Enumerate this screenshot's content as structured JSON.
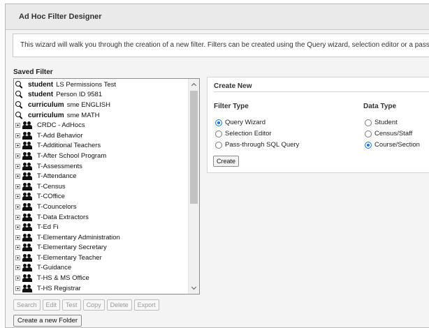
{
  "window": {
    "title": "Ad Hoc Filter Designer",
    "intro": "This wizard will walk you through the creation of a new filter. Filters can be created using the Query wizard, selection editor or a pass-through"
  },
  "saved_filter": {
    "label": "Saved Filter",
    "searches": [
      {
        "bold": "student",
        "text": "LS Permissions Test"
      },
      {
        "bold": "student",
        "text": "Person ID 9581"
      },
      {
        "bold": "curriculum",
        "text": "sme ENGLISH"
      },
      {
        "bold": "curriculum",
        "text": "sme MATH"
      }
    ],
    "folders": [
      "CRDC - AdHocs",
      "T-Add Behavior",
      "T-Additional Teachers",
      "T-After School Program",
      "T-Assessments",
      "T-Attendance",
      "T-Census",
      "T-COffice",
      "T-Councelors",
      "T-Data Extractors",
      "T-Ed Fi",
      "T-Elementary Administration",
      "T-Elementary Secretary",
      "T-Elementary Teacher",
      "T-Guidance",
      "T-HS & MS Office",
      "T-HS Registrar"
    ]
  },
  "actions": {
    "search": "Search",
    "edit": "Edit",
    "test": "Test",
    "copy": "Copy",
    "delete": "Delete",
    "export": "Export",
    "new_folder": "Create a new Folder"
  },
  "create_new": {
    "title": "Create New",
    "filter_type_label": "Filter Type",
    "data_type_label": "Data Type",
    "filter_types": [
      {
        "label": "Query Wizard",
        "checked": true
      },
      {
        "label": "Selection Editor",
        "checked": false
      },
      {
        "label": "Pass-through SQL Query",
        "checked": false
      }
    ],
    "data_types": [
      {
        "label": "Student",
        "checked": false
      },
      {
        "label": "Census/Staff",
        "checked": false
      },
      {
        "label": "Course/Section",
        "checked": true
      }
    ],
    "create_label": "Create"
  },
  "colors": {
    "radio_checked": "#1a73e8",
    "frame_bg": "#f4f4f4"
  }
}
